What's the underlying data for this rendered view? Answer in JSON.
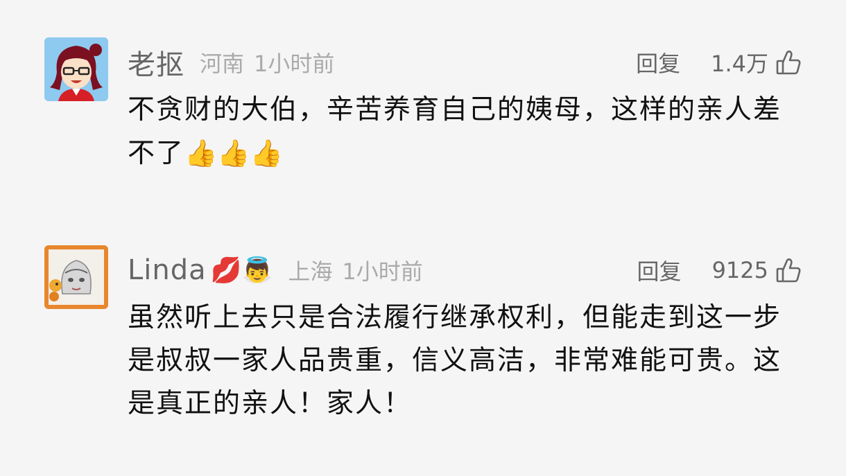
{
  "comments": [
    {
      "user": "老抠",
      "user_emojis": "",
      "location": "河南",
      "time": "1小时前",
      "reply_label": "回复",
      "likes": "1.4万",
      "text": "不贪财的大伯，辛苦养育自己的姨母，这样的亲人差不了",
      "text_emojis": "👍👍👍"
    },
    {
      "user": "Linda",
      "user_emojis": "💋👼",
      "location": "上海",
      "time": "1小时前",
      "reply_label": "回复",
      "likes": "9125",
      "text": "虽然听上去只是合法履行继承权利，但能走到这一步是叔叔一家人品贵重，信义高洁，非常难能可贵。这是真正的亲人！家人！",
      "text_emojis": ""
    }
  ],
  "icons": {
    "like": "thumbs-up-outline-icon"
  },
  "colors": {
    "background": "#f5f5f5",
    "username": "#666666",
    "meta": "#aaaaaa",
    "text": "#111111"
  }
}
